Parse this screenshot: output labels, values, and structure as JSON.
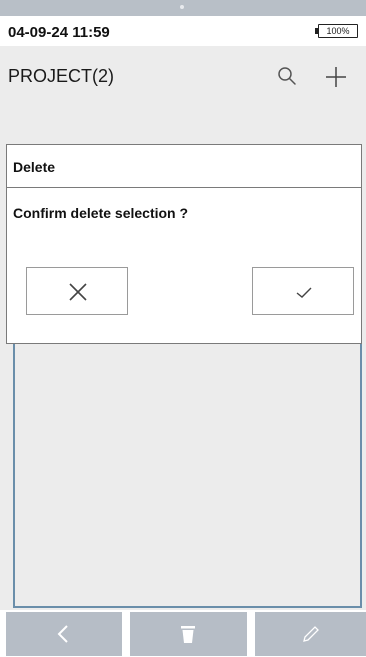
{
  "status": {
    "datetime": "04-09-24 11:59",
    "battery": "100%"
  },
  "header": {
    "title": "PROJECT(2)"
  },
  "toolbar": {
    "search_icon": "search-icon",
    "add_icon": "plus-icon"
  },
  "dialog": {
    "title": "Delete",
    "message": "Confirm delete selection ?",
    "cancel_icon": "close-icon",
    "confirm_icon": "check-icon"
  },
  "bottom_nav": {
    "back_icon": "chevron-left-icon",
    "delete_icon": "trash-icon",
    "edit_icon": "pencil-icon"
  },
  "colors": {
    "nav_bar": "#b6bdc6",
    "list_border": "#6a8eaa",
    "background": "#ececec"
  }
}
